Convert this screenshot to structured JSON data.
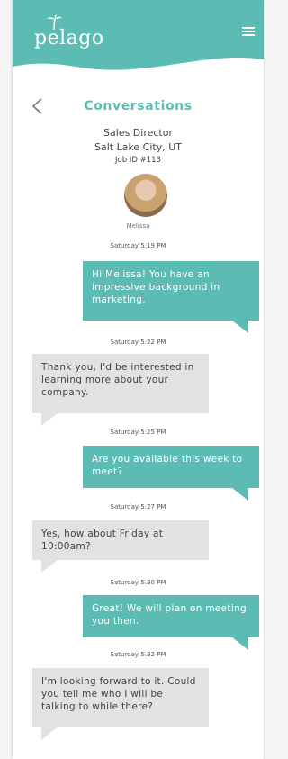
{
  "header": {
    "logo_text": "pelago",
    "brand_color": "#5cbcb3"
  },
  "nav": {
    "back_icon": "chevron-left-icon",
    "title": "Conversations",
    "menu_icon": "hamburger-menu-icon"
  },
  "job": {
    "title": "Sales Director",
    "location": "Salt Lake City, UT",
    "id": "Job ID #113"
  },
  "contact": {
    "name": "Melissa"
  },
  "messages": [
    {
      "timestamp": "Saturday 5:19 PM",
      "sender": "self",
      "text": "Hi Melissa! You have an impressive background in marketing."
    },
    {
      "timestamp": "Saturday 5:22 PM",
      "sender": "other",
      "text": "Thank you, I'd be interested in learning more about your company."
    },
    {
      "timestamp": "Saturday 5:25 PM",
      "sender": "self",
      "text": "Are you available this week to meet?"
    },
    {
      "timestamp": "Saturday 5:27 PM",
      "sender": "other",
      "text": "Yes, how about Friday at 10:00am?"
    },
    {
      "timestamp": "Saturday 5:30 PM",
      "sender": "self",
      "text": "Great! We will plan on meeting you then."
    },
    {
      "timestamp": "Saturday 5:32 PM",
      "sender": "other",
      "text": "I'm looking forward to it. Could you tell me who I will be talking to while there?"
    }
  ]
}
